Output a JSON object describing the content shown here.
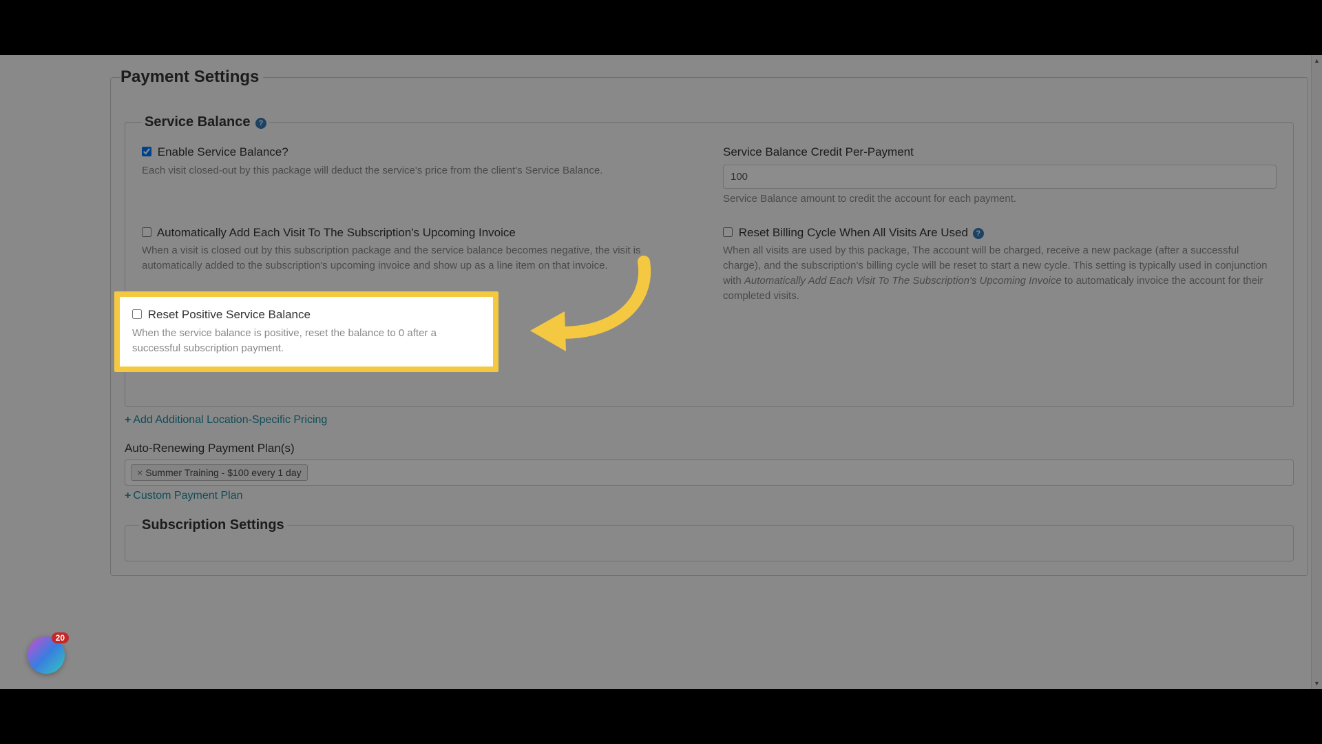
{
  "page": {
    "title": "Payment Settings"
  },
  "serviceBalance": {
    "legend": "Service Balance",
    "enable": {
      "label": "Enable Service Balance?",
      "checked": true,
      "desc": "Each visit closed-out by this package will deduct the service's price from the client's Service Balance."
    },
    "credit": {
      "label": "Service Balance Credit Per-Payment",
      "value": "100",
      "desc": "Service Balance amount to credit the account for each payment."
    },
    "autoAdd": {
      "label": "Automatically Add Each Visit To The Subscription's Upcoming Invoice",
      "checked": false,
      "desc": "When a visit is closed out by this subscription package and the service balance becomes negative, the visit is automatically added to the subscription's upcoming invoice and show up as a line item on that invoice."
    },
    "resetCycle": {
      "label": "Reset Billing Cycle When All Visits Are Used",
      "checked": false,
      "desc_a": "When all visits are used by this package, The account will be charged, receive a new package (after a successful charge), and the subscription's billing cycle will be reset to start a new cycle. This setting is typically used in conjunction with ",
      "desc_em": "Automatically Add Each Visit To The Subscription's Upcoming Invoice",
      "desc_b": " to automaticaly invoice the account for their completed visits."
    },
    "resetPositive": {
      "label": "Reset Positive Service Balance",
      "checked": false,
      "desc": "When the service balance is positive, reset the balance to 0 after a successful subscription payment."
    }
  },
  "links": {
    "addLocationPricing": "Add Additional Location-Specific Pricing",
    "customPaymentPlan": "Custom Payment Plan"
  },
  "autoRenew": {
    "label": "Auto-Renewing Payment Plan(s)",
    "tag": "Summer Training - $100 every 1 day"
  },
  "subSettings": {
    "legend": "Subscription Settings"
  },
  "widget": {
    "count": "20"
  },
  "helpGlyph": "?"
}
